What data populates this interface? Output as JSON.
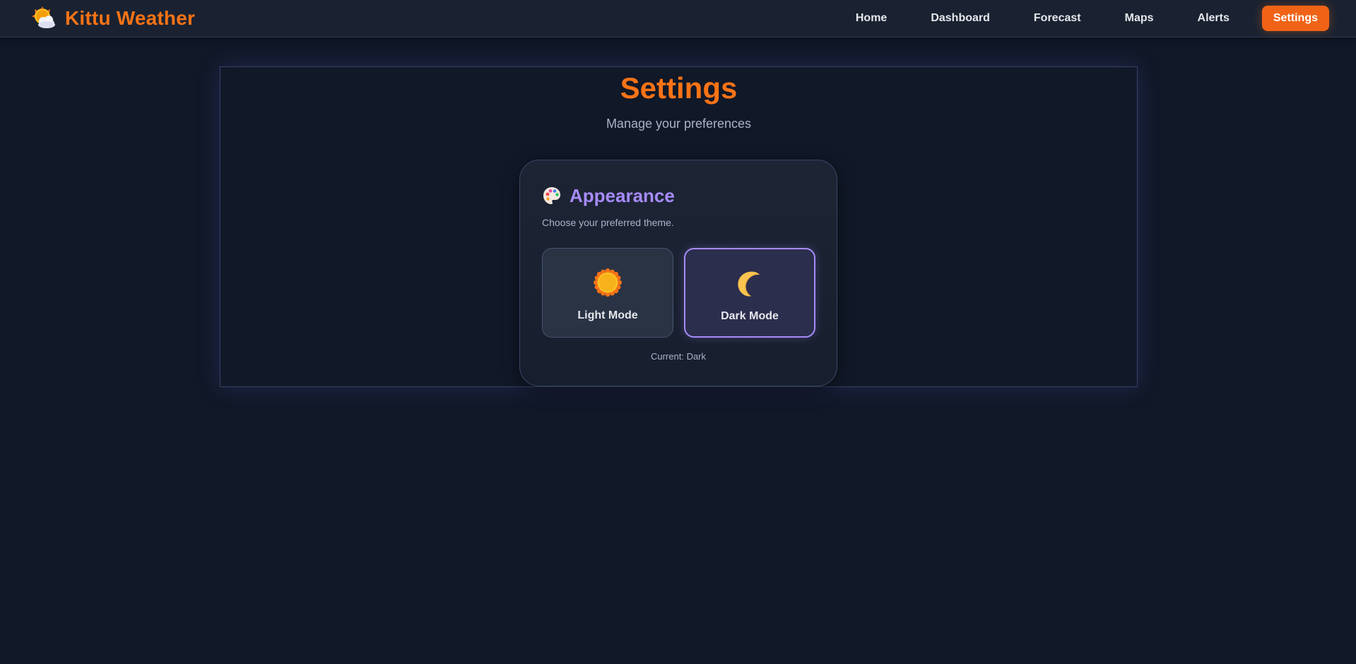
{
  "app": {
    "title": "Kittu Weather",
    "logo_icon": "sun-behind-cloud-icon"
  },
  "nav": {
    "items": [
      {
        "label": "Home",
        "active": false
      },
      {
        "label": "Dashboard",
        "active": false
      },
      {
        "label": "Forecast",
        "active": false
      },
      {
        "label": "Maps",
        "active": false
      },
      {
        "label": "Alerts",
        "active": false
      },
      {
        "label": "Settings",
        "active": true
      }
    ]
  },
  "page": {
    "title": "Settings",
    "subtitle": "Manage your preferences"
  },
  "appearance": {
    "icon": "palette-icon",
    "title": "Appearance",
    "description": "Choose your preferred theme.",
    "options": [
      {
        "label": "Light Mode",
        "icon": "sun-icon",
        "selected": false
      },
      {
        "label": "Dark Mode",
        "icon": "crescent-moon-icon",
        "selected": true
      }
    ],
    "current_label": "Current:",
    "current_value": "Dark"
  },
  "colors": {
    "accent_orange": "#f97316",
    "accent_purple": "#a78bfa",
    "background": "#111827"
  }
}
